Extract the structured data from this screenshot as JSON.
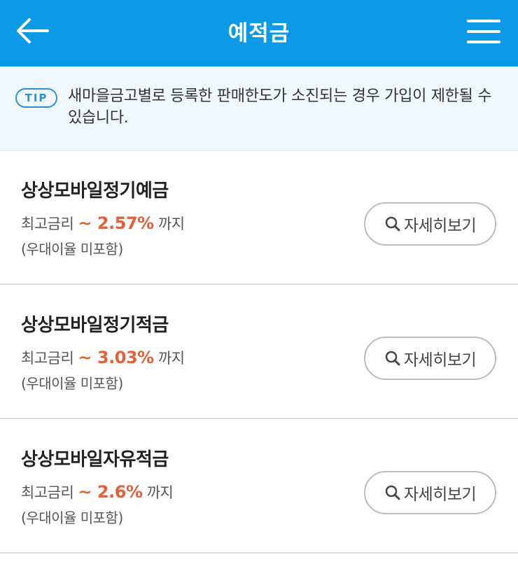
{
  "header": {
    "title": "예적금",
    "back_icon": "arrow-left-icon",
    "menu_icon": "hamburger-menu-icon",
    "color": "#0c9ae6"
  },
  "tip": {
    "badge": "TIP",
    "text": "새마을금고별로 등록한 판매한도가 소진되는 경우 가입이 제한될 수 있습니다."
  },
  "products": [
    {
      "name": "상상모바일정기예금",
      "rate_label": "최고금리",
      "rate_value": "~ 2.57%",
      "rate_suffix": "까지",
      "note": "(우대이율 미포함)",
      "detail_button": "자세히보기"
    },
    {
      "name": "상상모바일정기적금",
      "rate_label": "최고금리",
      "rate_value": "~ 3.03%",
      "rate_suffix": "까지",
      "note": "(우대이율 미포함)",
      "detail_button": "자세히보기"
    },
    {
      "name": "상상모바일자유적금",
      "rate_label": "최고금리",
      "rate_value": "~ 2.6%",
      "rate_suffix": "까지",
      "note": "(우대이율 미포함)",
      "detail_button": "자세히보기"
    }
  ],
  "colors": {
    "accent": "#0c9ae6",
    "rate": "#e0613a",
    "tip_border": "#2e8fd6"
  }
}
